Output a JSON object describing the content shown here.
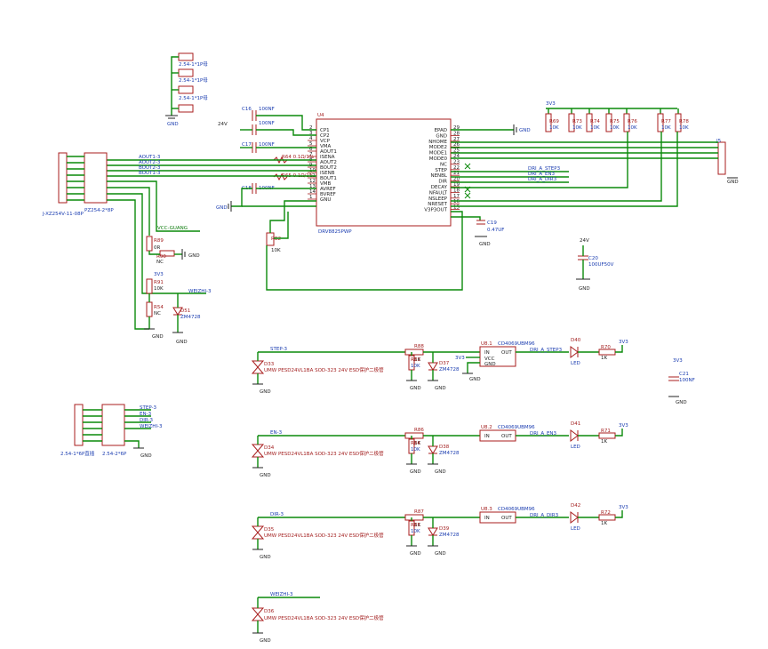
{
  "ic_main": {
    "ref": "U4",
    "value": "DRV8825PWP",
    "left_pins": [
      {
        "num": "2",
        "name": "CP1"
      },
      {
        "num": "3",
        "name": "CP2"
      },
      {
        "num": "4",
        "name": "VCP"
      },
      {
        "num": "5",
        "name": "VMA"
      },
      {
        "num": "6",
        "name": "AOUT1"
      },
      {
        "num": "7",
        "name": "ISENA"
      },
      {
        "num": "8",
        "name": "AOUT2"
      },
      {
        "num": "9",
        "name": "BOUT2"
      },
      {
        "num": "10",
        "name": "ISENB"
      },
      {
        "num": "11",
        "name": "BOUT1"
      },
      {
        "num": "12",
        "name": "VMB"
      },
      {
        "num": "13",
        "name": "AVREF"
      },
      {
        "num": "14",
        "name": "BVREF"
      },
      {
        "num": "1",
        "name": "GNU"
      }
    ],
    "right_pins": [
      {
        "num": "29",
        "name": "EPAD"
      },
      {
        "num": "28",
        "name": "GND"
      },
      {
        "num": "27",
        "name": "NHOME"
      },
      {
        "num": "26",
        "name": "MODE2"
      },
      {
        "num": "25",
        "name": "MODE1"
      },
      {
        "num": "24",
        "name": "MODE0"
      },
      {
        "num": "23",
        "name": "NC"
      },
      {
        "num": "22",
        "name": "STEP"
      },
      {
        "num": "21",
        "name": "NENBL"
      },
      {
        "num": "20",
        "name": "DIR"
      },
      {
        "num": "19",
        "name": "DECAY"
      },
      {
        "num": "18",
        "name": "NFAULT"
      },
      {
        "num": "17",
        "name": "NSLEEP"
      },
      {
        "num": "16",
        "name": "NRESET"
      },
      {
        "num": "15",
        "name": "V3P3OUT"
      }
    ]
  },
  "small_labels": {
    "top_headers": [
      "2.54-1*1P母",
      "2.54-1*1P母",
      "2.54-1*1P母"
    ],
    "gnd": "GND",
    "v3": "3V3",
    "v24": "24V",
    "cap_caps": [
      "C16",
      "C15",
      "C17",
      "C18",
      "C19",
      "C20",
      "C21"
    ],
    "cap_values": [
      "100NF",
      "100NF",
      "100NF",
      "100NF",
      "0.47UF",
      "100UF50V",
      "100NF"
    ],
    "res_right": [
      "R69",
      "R73",
      "R74",
      "R75",
      "R76",
      "R77",
      "R78"
    ],
    "res_right_value": "10K",
    "r_sense": [
      "R64 0.1Ω/1%",
      "R65 0.1Ω/1%"
    ],
    "pot": {
      "ref": "RB2",
      "value": "10K"
    },
    "net_aout1": "AOUT1-3",
    "net_aout2": "AOUT2-3",
    "net_bout2": "BOUT2-3",
    "net_bout1": "BOUT1-3",
    "vcc_guang": "VCC-GUANG",
    "weizhi": "WEIZHI-3",
    "step": "STEP-3",
    "en": "EN-3",
    "dir": "DIR-3",
    "drv_step": "DRI_A_STEP3",
    "drv_en": "DRI_A_EN3",
    "drv_dir": "DRI_A_DIR3",
    "conn_j": "J-XZ254V-11-08P",
    "conn_p": "PZ254-2*8P",
    "conn_j2": "2.54-1*6P直插",
    "conn_p2": "2.54-2*6P",
    "r_nc": "NC",
    "r_0r": "0R",
    "r_1k": "1K",
    "led": "LED",
    "zener": "ZM4728",
    "esd": "UMW PESD24VL1BA SOD-323 24V ESD保护二极管",
    "buffer": "CD4069UBM96",
    "buf_in": "IN",
    "buf_out": "OUT",
    "buf_vcc": "VCC",
    "buf_gnd": "GND",
    "u_refs": [
      "U8.1",
      "U8.2",
      "U8.3"
    ],
    "d_refs": [
      "D40",
      "D41",
      "D42"
    ],
    "d_esd": [
      "D33",
      "D34",
      "D35",
      "D36"
    ],
    "d_zen": [
      "D37",
      "D38",
      "D39",
      "D51"
    ],
    "r_led": [
      "R70",
      "R71",
      "R72"
    ],
    "r_in": [
      "R88",
      "R86",
      "R87"
    ],
    "r_pd": [
      "R83",
      "R84",
      "R85"
    ],
    "r_left": [
      "R89",
      "R90",
      "R91",
      "R54"
    ],
    "j5": "J5"
  }
}
